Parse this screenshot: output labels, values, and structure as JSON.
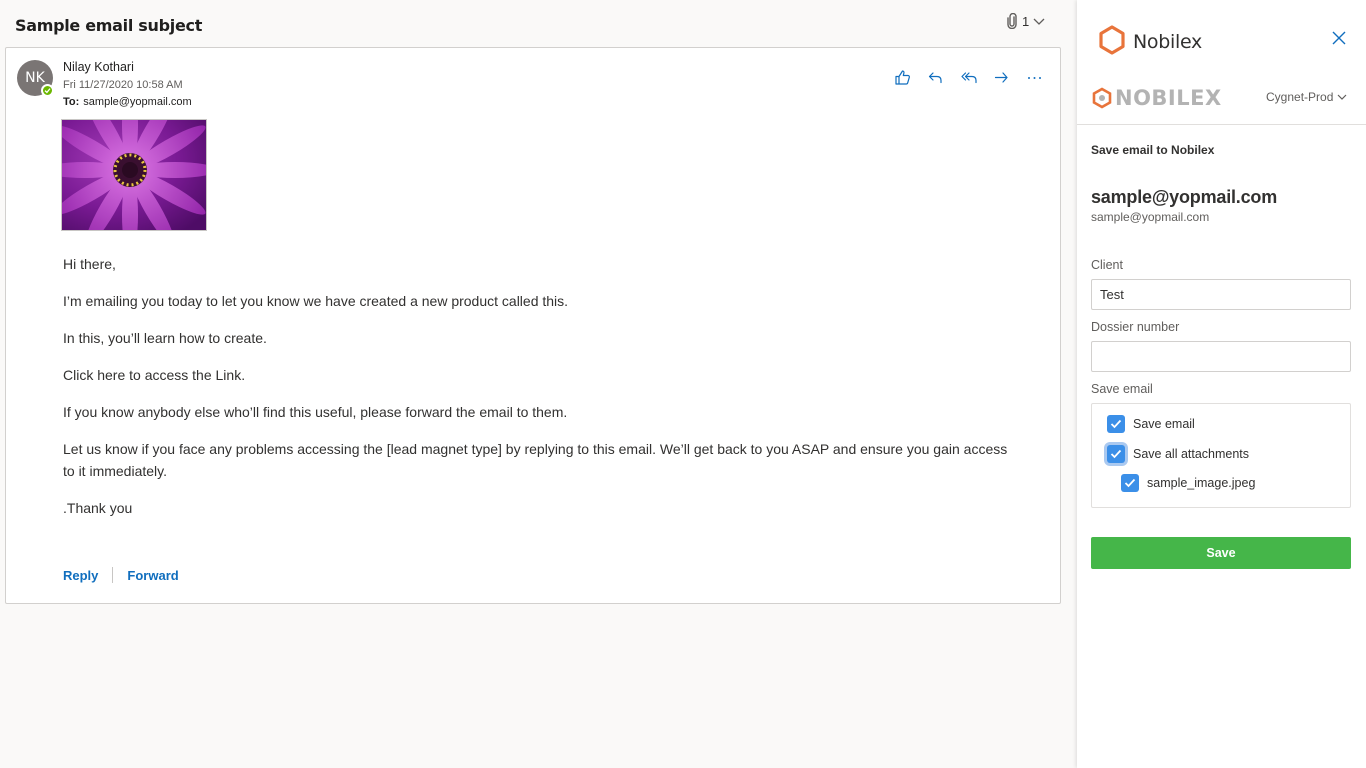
{
  "email": {
    "subject": "Sample email subject",
    "attachment_count": "1",
    "sender": {
      "initials": "NK",
      "name": "Nilay Kothari",
      "date": "Fri 11/27/2020 10:58 AM",
      "to_label": "To:",
      "to": "sample@yopmail.com"
    },
    "body": [
      "Hi there,",
      "I’m emailing you today to let you know we have created a new product called this.",
      "In this, you’ll learn how to create.",
      "Click here to access the Link.",
      "If you know anybody else who’ll find this useful, please forward the email to them.",
      "Let us know if you face any problems accessing the [lead magnet type] by replying to this email. We’ll get back to you ASAP and ensure you gain access to it immediately.",
      ".Thank you"
    ],
    "footer": {
      "reply": "Reply",
      "forward": "Forward"
    },
    "action_icons": [
      "like-icon",
      "reply-icon",
      "reply-all-icon",
      "forward-icon",
      "more-icon"
    ]
  },
  "addin": {
    "title": "Nobilex",
    "brand": "NOBILEX",
    "environment": "Cygnet-Prod",
    "save_heading": "Save email to Nobilex",
    "contact_name": "sample@yopmail.com",
    "contact_email": "sample@yopmail.com",
    "client_label": "Client",
    "client_value": "Test",
    "dossier_label": "Dossier number",
    "dossier_value": "",
    "save_email_label": "Save email",
    "options": {
      "save_email": "Save email",
      "save_all_attachments": "Save all attachments",
      "attachment_file": "sample_image.jpeg"
    },
    "save_button": "Save"
  },
  "colors": {
    "accent_blue": "#106ebe",
    "checkbox_blue": "#3b8fe8",
    "save_green": "#45b649",
    "brand_orange": "#e8743b"
  }
}
